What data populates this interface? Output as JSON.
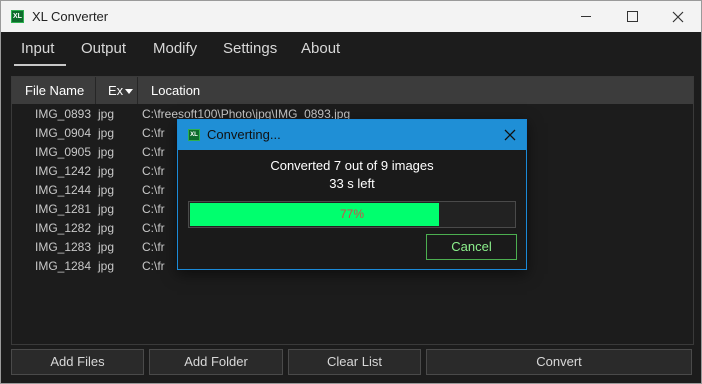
{
  "window": {
    "title": "XL Converter",
    "icon_text": "XL"
  },
  "tabs": [
    {
      "label": "Input",
      "active": true
    },
    {
      "label": "Output",
      "active": false
    },
    {
      "label": "Modify",
      "active": false
    },
    {
      "label": "Settings",
      "active": false
    },
    {
      "label": "About",
      "active": false
    }
  ],
  "table": {
    "columns": [
      "File Name",
      "Ex",
      "Location"
    ],
    "rows": [
      {
        "name": "IMG_0893",
        "ext": "jpg",
        "location": "C:\\freesoft100\\Photo\\jpg\\IMG_0893.jpg"
      },
      {
        "name": "IMG_0904",
        "ext": "jpg",
        "location": "C:\\fr"
      },
      {
        "name": "IMG_0905",
        "ext": "jpg",
        "location": "C:\\fr"
      },
      {
        "name": "IMG_1242",
        "ext": "jpg",
        "location": "C:\\fr"
      },
      {
        "name": "IMG_1244",
        "ext": "jpg",
        "location": "C:\\fr"
      },
      {
        "name": "IMG_1281",
        "ext": "jpg",
        "location": "C:\\fr"
      },
      {
        "name": "IMG_1282",
        "ext": "jpg",
        "location": "C:\\fr"
      },
      {
        "name": "IMG_1283",
        "ext": "jpg",
        "location": "C:\\fr"
      },
      {
        "name": "IMG_1284",
        "ext": "jpg",
        "location": "C:\\fr"
      }
    ]
  },
  "buttons": {
    "add_files": "Add Files",
    "add_folder": "Add Folder",
    "clear_list": "Clear List",
    "convert": "Convert"
  },
  "dialog": {
    "title": "Converting...",
    "icon_text": "XL",
    "message": "Converted 7 out of 9 images",
    "time_left": "33 s left",
    "progress_percent": 77,
    "progress_label": "77%",
    "cancel_label": "Cancel"
  },
  "colors": {
    "accent": "#1f8fd6",
    "progress_fill": "#00ff6e",
    "progress_text": "#d04a4a",
    "cancel_border": "#4caf50"
  }
}
